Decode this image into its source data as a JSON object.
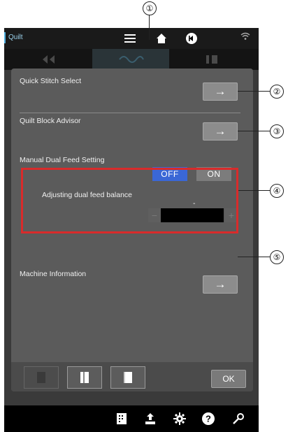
{
  "topbar": {
    "title": "Quilt"
  },
  "dialog": {
    "quick_stitch": {
      "label": "Quick Stitch Select",
      "button": "→"
    },
    "quilt_block": {
      "label": "Quilt Block Advisor",
      "button": "→"
    },
    "dual_feed": {
      "label": "Manual Dual Feed Setting",
      "off_label": "OFF",
      "on_label": "ON",
      "selected": "OFF",
      "balance_label": "Adjusting dual feed balance",
      "balance_value": "-",
      "minus_label": "−",
      "plus_label": "+"
    },
    "machine_info": {
      "label": "Machine Information",
      "button": "→"
    },
    "ok_label": "OK"
  },
  "callouts": [
    "①",
    "②",
    "③",
    "④",
    "⑤"
  ],
  "colors": {
    "accent_selected": "#3a67d6",
    "highlight_box": "#d92b2b",
    "dialog_bg": "#5b5b5b"
  },
  "icons": [
    "menu-icon",
    "home-icon",
    "back-icon",
    "wifi-icon",
    "stitch-chart-icon",
    "upload-icon",
    "gear-icon",
    "help-icon",
    "wrench-icon"
  ]
}
